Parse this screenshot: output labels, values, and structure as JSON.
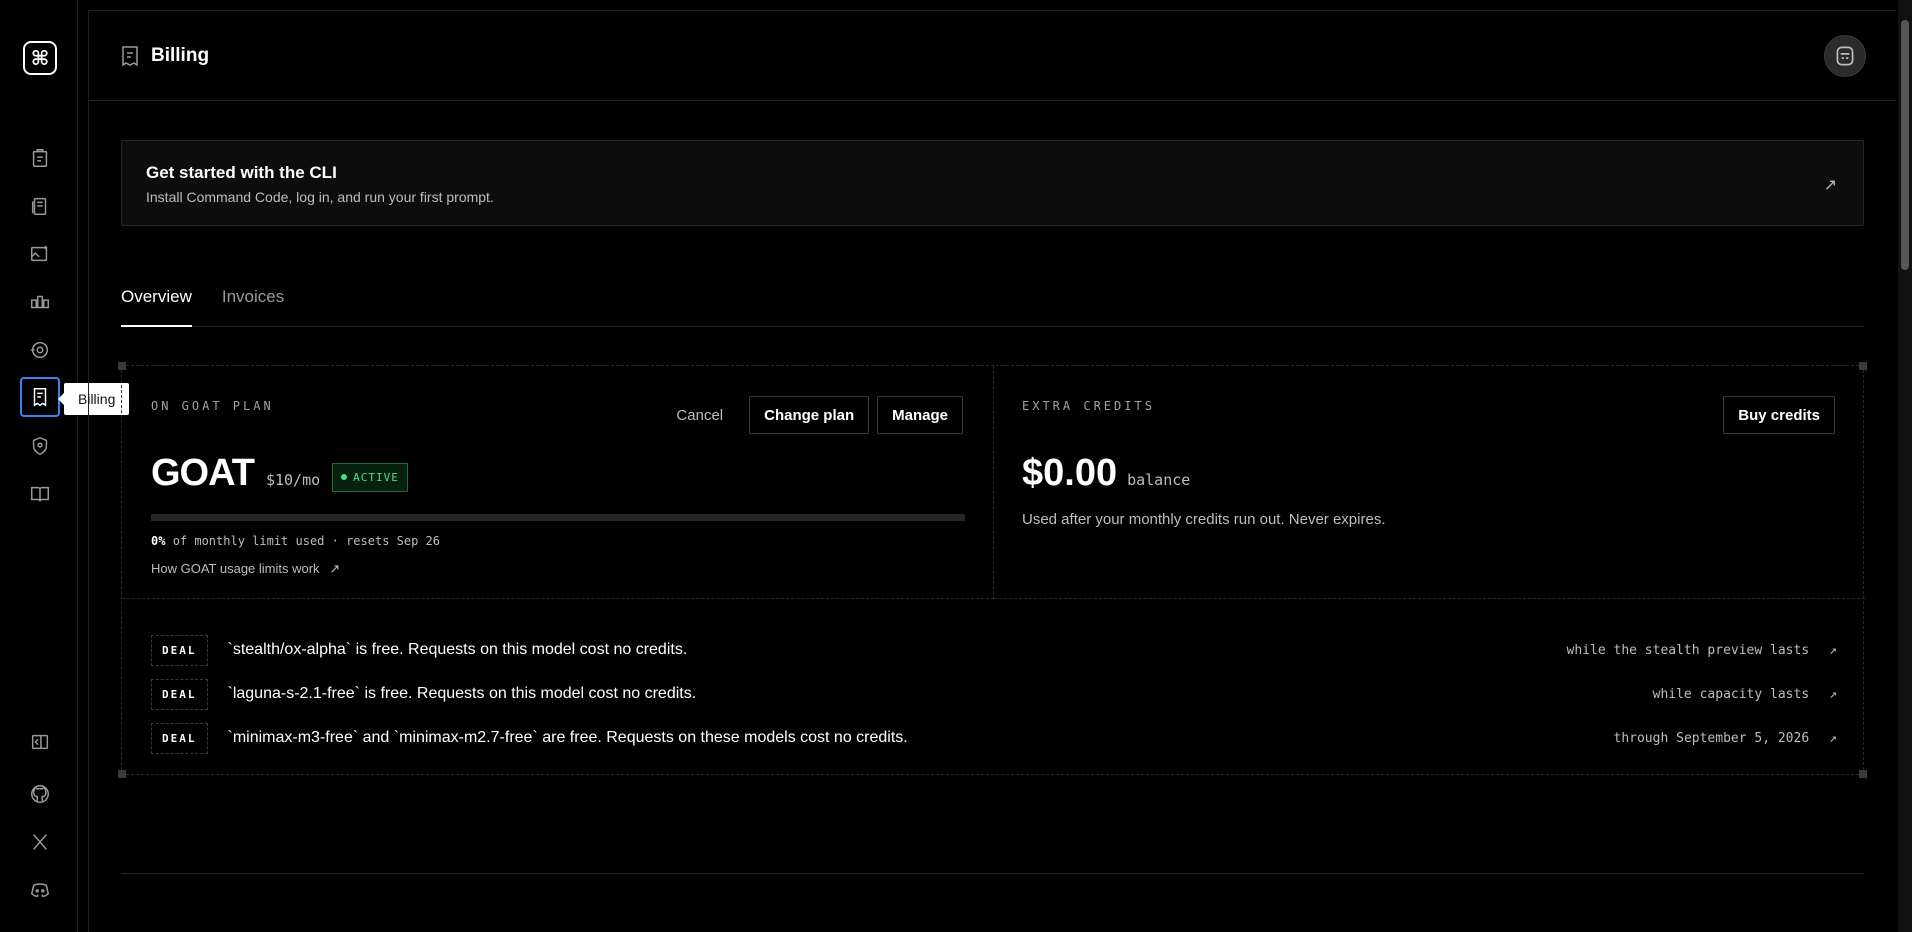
{
  "sidebar": {
    "logo_glyph": "⌘",
    "tooltip": "Billing",
    "active_item": "billing"
  },
  "header": {
    "title": "Billing"
  },
  "cli_banner": {
    "title": "Get started with the CLI",
    "subtitle": "Install Command Code, log in, and run your first prompt.",
    "arrow": "↗"
  },
  "tabs": [
    {
      "label": "Overview",
      "active": true
    },
    {
      "label": "Invoices",
      "active": false
    }
  ],
  "plan": {
    "label": "ON GOAT PLAN",
    "cancel_label": "Cancel",
    "change_label": "Change plan",
    "manage_label": "Manage",
    "name": "GOAT",
    "price": "$10/mo",
    "status": "ACTIVE",
    "usage_percent": "0%",
    "usage_value": 0,
    "usage_text": "of monthly limit used · resets Sep 26",
    "limits_link": "How GOAT usage limits work",
    "link_arrow": "↗"
  },
  "credits": {
    "label": "EXTRA CREDITS",
    "buy_label": "Buy credits",
    "amount": "$0.00",
    "balance_label": "balance",
    "description": "Used after your monthly credits run out. Never expires."
  },
  "deals": [
    {
      "tag": "DEAL",
      "text": "`stealth/ox-alpha` is free. Requests on this model cost no credits.",
      "meta": "while the stealth preview lasts",
      "arrow": "↗"
    },
    {
      "tag": "DEAL",
      "text": "`laguna-s-2.1-free` is free. Requests on this model cost no credits.",
      "meta": "while capacity lasts",
      "arrow": "↗"
    },
    {
      "tag": "DEAL",
      "text": "`minimax-m3-free` and `minimax-m2.7-free` are free. Requests on these models cost no credits.",
      "meta": "through September 5, 2026",
      "arrow": "↗"
    }
  ],
  "colors": {
    "accent": "#3b82f6",
    "active_badge": "#4ade80"
  }
}
